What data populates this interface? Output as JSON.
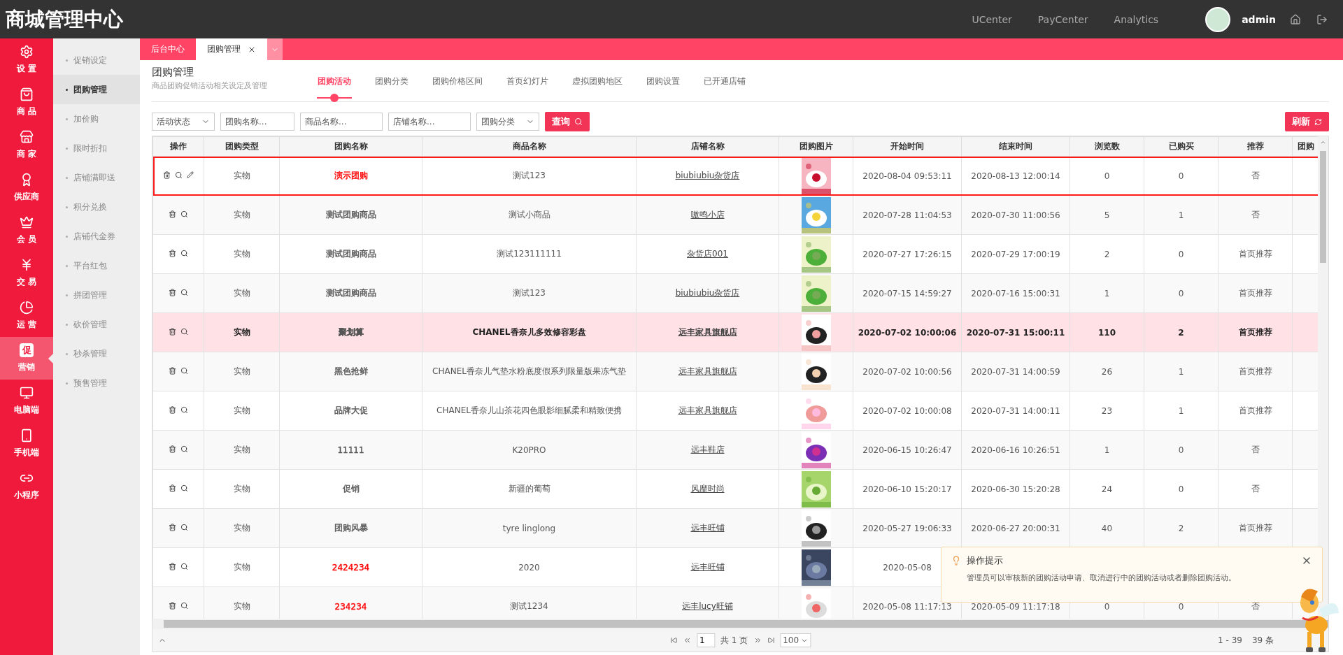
{
  "header": {
    "title": "商城管理中心",
    "links": [
      "UCenter",
      "PayCenter",
      "Analytics"
    ],
    "user": "admin"
  },
  "nav": [
    {
      "label": "设 置",
      "selected": false
    },
    {
      "label": "商 品",
      "selected": false
    },
    {
      "label": "商 家",
      "selected": false
    },
    {
      "label": "供应商",
      "selected": false
    },
    {
      "label": "会 员",
      "selected": false
    },
    {
      "label": "交 易",
      "selected": false
    },
    {
      "label": "运 营",
      "selected": false
    },
    {
      "label": "营销",
      "selected": true,
      "badge": "促"
    },
    {
      "label": "电脑端",
      "selected": false
    },
    {
      "label": "手机端",
      "selected": false
    },
    {
      "label": "小程序",
      "selected": false
    }
  ],
  "subnav": [
    {
      "label": "促销设定",
      "selected": false
    },
    {
      "label": "团购管理",
      "selected": true
    },
    {
      "label": "加价购",
      "selected": false
    },
    {
      "label": "限时折扣",
      "selected": false
    },
    {
      "label": "店铺满即送",
      "selected": false
    },
    {
      "label": "积分兑换",
      "selected": false
    },
    {
      "label": "店铺代金券",
      "selected": false
    },
    {
      "label": "平台红包",
      "selected": false
    },
    {
      "label": "拼团管理",
      "selected": false
    },
    {
      "label": "砍价管理",
      "selected": false
    },
    {
      "label": "秒杀管理",
      "selected": false
    },
    {
      "label": "预售管理",
      "selected": false
    }
  ],
  "window_tabs": [
    {
      "label": "后台中心",
      "selected": false,
      "closable": false
    },
    {
      "label": "团购管理",
      "selected": true,
      "closable": true
    }
  ],
  "page": {
    "title": "团购管理",
    "subtitle": "商品团购促销活动相关设定及管理"
  },
  "tabs": [
    {
      "label": "团购活动",
      "selected": true
    },
    {
      "label": "团购分类",
      "selected": false
    },
    {
      "label": "团购价格区间",
      "selected": false
    },
    {
      "label": "首页幻灯片",
      "selected": false
    },
    {
      "label": "虚拟团购地区",
      "selected": false
    },
    {
      "label": "团购设置",
      "selected": false
    },
    {
      "label": "已开通店铺",
      "selected": false
    }
  ],
  "filters": [
    {
      "kind": "select",
      "value": "活动状态"
    },
    {
      "kind": "input",
      "placeholder": "团购名称..."
    },
    {
      "kind": "input",
      "placeholder": "商品名称..."
    },
    {
      "kind": "input",
      "placeholder": "店铺名称..."
    },
    {
      "kind": "select",
      "value": "团购分类"
    }
  ],
  "search_button": "查询",
  "refresh_button": "刷新",
  "table": {
    "columns": [
      "操作",
      "团购类型",
      "团购名称",
      "商品名称",
      "店铺名称",
      "团购图片",
      "开始时间",
      "结束时间",
      "浏览数",
      "已购买",
      "推荐",
      "团购"
    ],
    "rows": [
      {
        "type": "实物",
        "name": "演示团购",
        "color": "#ff0000",
        "goods": "测试123",
        "store": "biubiubiu杂货店",
        "start": "2020-08-04 09:53:11",
        "end": "2020-08-13 12:00:14",
        "views": "0",
        "bought": "0",
        "recommend": "否",
        "selected": true,
        "highlighted": false,
        "editable": true
      },
      {
        "type": "实物",
        "name": "测试团购商品",
        "color": "#555555",
        "goods": "测试小商品",
        "store": "嗷鸣小店",
        "start": "2020-07-28 11:04:53",
        "end": "2020-07-30 11:00:56",
        "views": "5",
        "bought": "1",
        "recommend": "否",
        "selected": false,
        "highlighted": false,
        "editable": false
      },
      {
        "type": "实物",
        "name": "测试团购商品",
        "color": "#555555",
        "goods": "测试123111111",
        "store": "杂货店001",
        "start": "2020-07-27 17:26:15",
        "end": "2020-07-29 17:00:19",
        "views": "2",
        "bought": "0",
        "recommend": "首页推荐",
        "selected": false,
        "highlighted": false,
        "editable": false
      },
      {
        "type": "实物",
        "name": "测试团购商品",
        "color": "#555555",
        "goods": "测试123",
        "store": "biubiubiu杂货店",
        "start": "2020-07-15 14:59:27",
        "end": "2020-07-16 15:00:31",
        "views": "1",
        "bought": "0",
        "recommend": "首页推荐",
        "selected": false,
        "highlighted": false,
        "editable": false
      },
      {
        "type": "实物",
        "name": "聚划算",
        "color": "#555555",
        "goods": "CHANEL香奈儿多效修容彩盘",
        "store": "远丰家具旗舰店",
        "start": "2020-07-02 10:00:06",
        "end": "2020-07-31 15:00:11",
        "views": "110",
        "bought": "2",
        "recommend": "首页推荐",
        "selected": false,
        "highlighted": true,
        "editable": false
      },
      {
        "type": "实物",
        "name": "黑色抢鲜",
        "color": "#555555",
        "goods": "CHANEL香奈儿气垫水粉底度假系列限量版果冻气垫",
        "store": "远丰家具旗舰店",
        "start": "2020-07-02 10:00:56",
        "end": "2020-07-31 14:00:59",
        "views": "26",
        "bought": "1",
        "recommend": "首页推荐",
        "selected": false,
        "highlighted": false,
        "editable": false
      },
      {
        "type": "实物",
        "name": "品牌大促",
        "color": "#555555",
        "goods": "CHANEL香奈儿山茶花四色眼影细腻柔和精致便携",
        "store": "远丰家具旗舰店",
        "start": "2020-07-02 10:00:08",
        "end": "2020-07-31 14:00:11",
        "views": "23",
        "bought": "1",
        "recommend": "首页推荐",
        "selected": false,
        "highlighted": false,
        "editable": false
      },
      {
        "type": "实物",
        "name": "11111",
        "color": "#555555",
        "goods": "K20PRO",
        "store": "远丰鞋店",
        "start": "2020-06-15 10:26:47",
        "end": "2020-06-16 10:26:51",
        "views": "1",
        "bought": "0",
        "recommend": "否",
        "selected": false,
        "highlighted": false,
        "editable": false
      },
      {
        "type": "实物",
        "name": "促销",
        "color": "#555555",
        "goods": "新疆的葡萄",
        "store": "风靡时尚",
        "start": "2020-06-10 15:20:17",
        "end": "2020-06-30 15:20:28",
        "views": "24",
        "bought": "0",
        "recommend": "否",
        "selected": false,
        "highlighted": false,
        "editable": false
      },
      {
        "type": "实物",
        "name": "团购风暴",
        "color": "#555555",
        "goods": "tyre linglong",
        "store": "远丰旺铺",
        "start": "2020-05-27 19:06:33",
        "end": "2020-06-27 20:00:31",
        "views": "40",
        "bought": "2",
        "recommend": "首页推荐",
        "selected": false,
        "highlighted": false,
        "editable": false
      },
      {
        "type": "实物",
        "name": "2424234",
        "color": "#ff0000",
        "goods": "2020",
        "store": "远丰旺铺",
        "start": "2020-05-08",
        "selected": false,
        "highlighted": false,
        "editable": false
      },
      {
        "type": "实物",
        "name": "234234",
        "color": "#ff0000",
        "goods": "测试1234",
        "store": "远丰lucy旺铺",
        "start": "2020-05-08 11:17:13",
        "end": "2020-05-09 11:17:18",
        "views": "0",
        "bought": "0",
        "recommend": "否",
        "selected": false,
        "highlighted": false,
        "editable": false
      }
    ]
  },
  "pager": {
    "page": "1",
    "pages": "共 1 页",
    "size": "100",
    "range": "1 - 39",
    "total": "39 条"
  },
  "tip": {
    "title": "操作提示",
    "text": "管理员可以审核新的团购活动申请、取消进行中的团购活动或者删除团购活动。"
  }
}
